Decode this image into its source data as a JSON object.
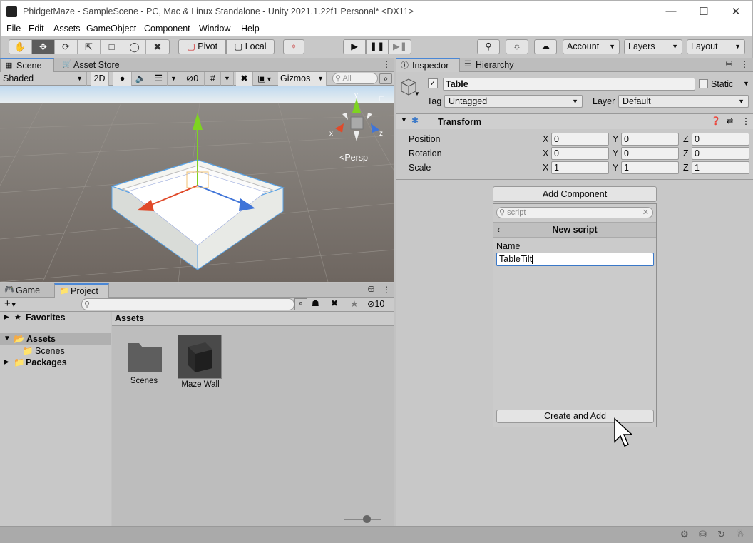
{
  "window": {
    "title": "PhidgetMaze - SampleScene - PC, Mac & Linux Standalone - Unity 2021.1.22f1 Personal* <DX11>"
  },
  "menu": [
    "File",
    "Edit",
    "Assets",
    "GameObject",
    "Component",
    "Window",
    "Help"
  ],
  "toolbar": {
    "pivot": "Pivot",
    "local": "Local",
    "account": "Account",
    "layers": "Layers",
    "layout": "Layout"
  },
  "scene": {
    "tabs": {
      "scene": "Scene",
      "asset_store": "Asset Store"
    },
    "shading": "Shaded",
    "mode_2d": "2D",
    "hidden_count": "0",
    "gizmos": "Gizmos",
    "search_placeholder": "All",
    "persp": "Persp",
    "axes": {
      "x": "x",
      "y": "y",
      "z": "z"
    }
  },
  "project": {
    "tabs": {
      "game": "Game",
      "project": "Project"
    },
    "hidden_count": "10",
    "tree": {
      "favorites": "Favorites",
      "assets": "Assets",
      "scenes": "Scenes",
      "packages": "Packages"
    },
    "breadcrumb": "Assets",
    "items": [
      {
        "label": "Scenes"
      },
      {
        "label": "Maze Wall"
      }
    ]
  },
  "inspector": {
    "tabs": {
      "inspector": "Inspector",
      "hierarchy": "Hierarchy"
    },
    "object_name": "Table",
    "static_label": "Static",
    "tag_label": "Tag",
    "tag_value": "Untagged",
    "layer_label": "Layer",
    "layer_value": "Default",
    "transform": {
      "title": "Transform",
      "rows": [
        {
          "label": "Position",
          "x": "0",
          "y": "0",
          "z": "0"
        },
        {
          "label": "Rotation",
          "x": "0",
          "y": "0",
          "z": "0"
        },
        {
          "label": "Scale",
          "x": "1",
          "y": "1",
          "z": "1"
        }
      ],
      "axis": {
        "x": "X",
        "y": "Y",
        "z": "Z"
      }
    },
    "add_component": "Add Component",
    "popup": {
      "search_value": "script",
      "header": "New script",
      "name_label": "Name",
      "name_value": "TableTilt",
      "create_button": "Create and Add"
    }
  }
}
